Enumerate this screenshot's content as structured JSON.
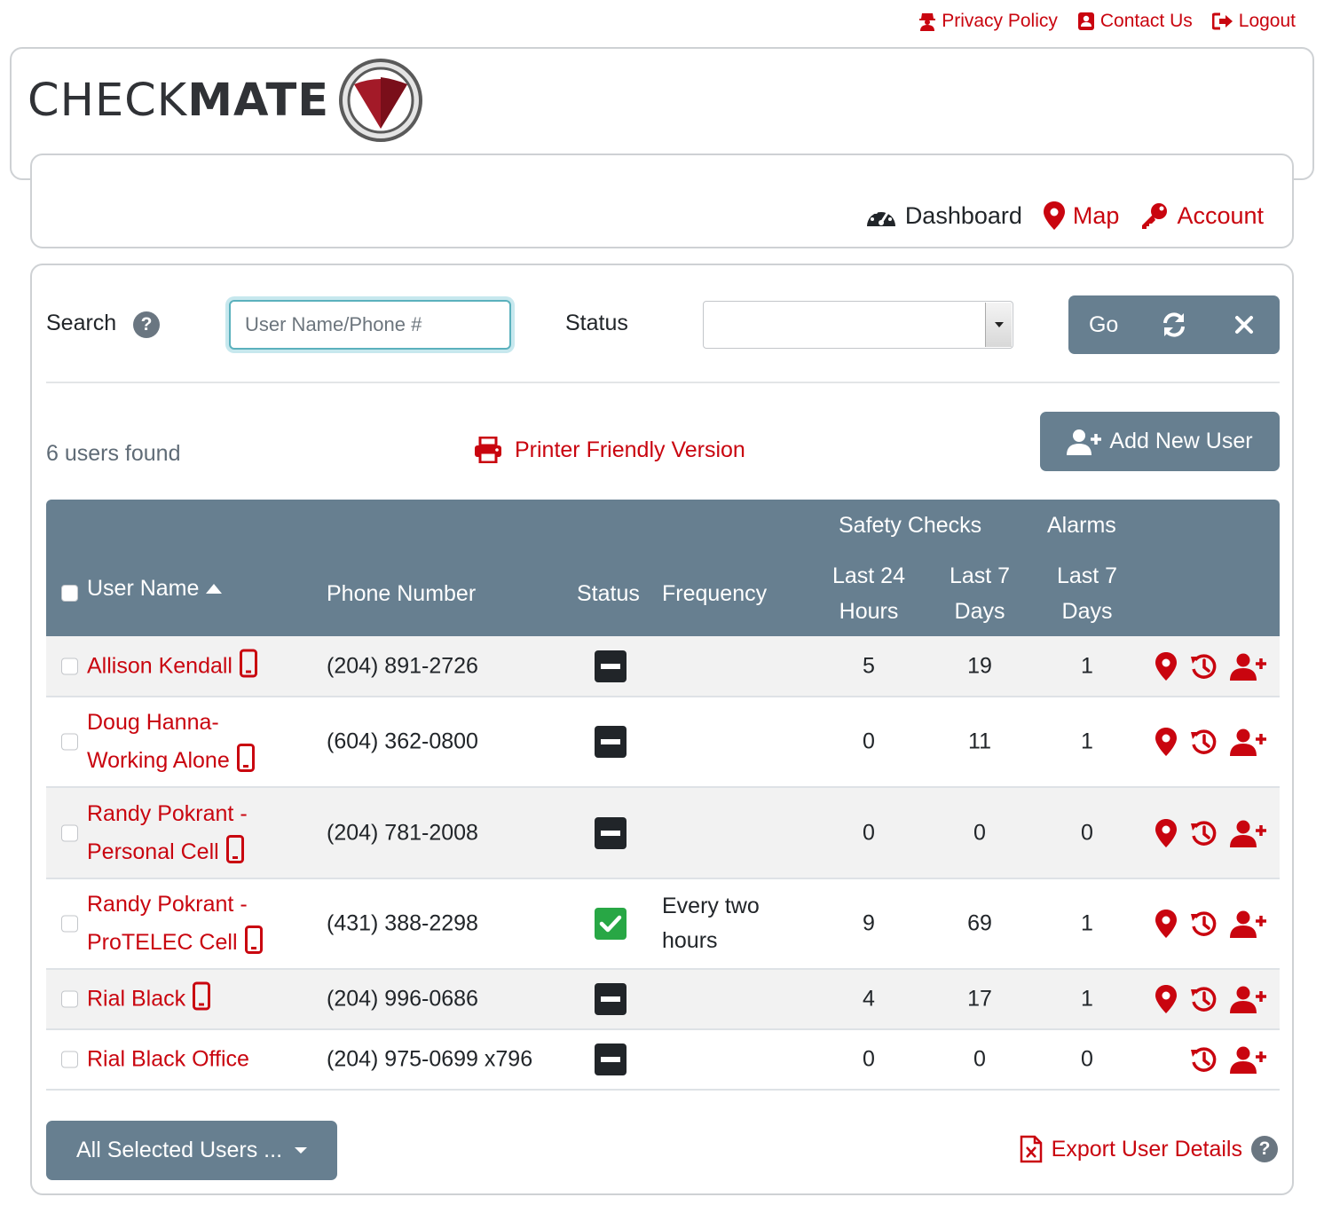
{
  "top_links": {
    "privacy": "Privacy Policy",
    "contact": "Contact Us",
    "logout": "Logout"
  },
  "logo": {
    "text_light": "CHECK",
    "text_bold": "MATE"
  },
  "nav": {
    "dashboard": "Dashboard",
    "map": "Map",
    "account": "Account"
  },
  "search": {
    "label": "Search",
    "help": "?",
    "placeholder": "User Name/Phone #",
    "value": "",
    "status_label": "Status",
    "status_value": "",
    "go": "Go"
  },
  "results": {
    "count_text": "6 users found",
    "printer": "Printer Friendly Version",
    "add_user": "Add New User"
  },
  "table": {
    "headers": {
      "user_name": "User Name",
      "phone": "Phone Number",
      "status": "Status",
      "frequency": "Frequency",
      "safety_checks": "Safety Checks",
      "alarms": "Alarms",
      "last24_line1": "Last 24",
      "last24_line2": "Hours",
      "last7_line1": "Last 7",
      "last7_line2": "Days",
      "alarm_last7_line1": "Last 7",
      "alarm_last7_line2": "Days"
    },
    "rows": [
      {
        "name_line1": "Allison Kendall",
        "name_line2": "",
        "phone": "(204) 891-2726",
        "status": "off",
        "frequency_line1": "",
        "frequency_line2": "",
        "checks_24h": "5",
        "checks_7d": "19",
        "alarms_7d": "1",
        "has_map": true,
        "has_mobile": true
      },
      {
        "name_line1": "Doug Hanna-",
        "name_line2": "Working Alone",
        "phone": "(604) 362-0800",
        "status": "off",
        "frequency_line1": "",
        "frequency_line2": "",
        "checks_24h": "0",
        "checks_7d": "11",
        "alarms_7d": "1",
        "has_map": true,
        "has_mobile": true
      },
      {
        "name_line1": "Randy Pokrant -",
        "name_line2": "Personal Cell",
        "phone": "(204) 781-2008",
        "status": "off",
        "frequency_line1": "",
        "frequency_line2": "",
        "checks_24h": "0",
        "checks_7d": "0",
        "alarms_7d": "0",
        "has_map": true,
        "has_mobile": true
      },
      {
        "name_line1": "Randy Pokrant -",
        "name_line2": "ProTELEC Cell",
        "phone": "(431) 388-2298",
        "status": "on",
        "frequency_line1": "Every two",
        "frequency_line2": "hours",
        "checks_24h": "9",
        "checks_7d": "69",
        "alarms_7d": "1",
        "has_map": true,
        "has_mobile": true
      },
      {
        "name_line1": "Rial Black",
        "name_line2": "",
        "phone": "(204) 996-0686",
        "status": "off",
        "frequency_line1": "",
        "frequency_line2": "",
        "checks_24h": "4",
        "checks_7d": "17",
        "alarms_7d": "1",
        "has_map": true,
        "has_mobile": true
      },
      {
        "name_line1": "Rial Black Office",
        "name_line2": "",
        "phone": "(204) 975-0699 x796",
        "status": "off",
        "frequency_line1": "",
        "frequency_line2": "",
        "checks_24h": "0",
        "checks_7d": "0",
        "alarms_7d": "0",
        "has_map": false,
        "has_mobile": false
      }
    ]
  },
  "footer": {
    "bulk_action": "All Selected Users ...",
    "export": "Export User Details",
    "export_help": "?"
  },
  "colors": {
    "brand_red": "#c9050f",
    "slate": "#677f90",
    "status_on": "#28a745",
    "status_off": "#212529"
  }
}
